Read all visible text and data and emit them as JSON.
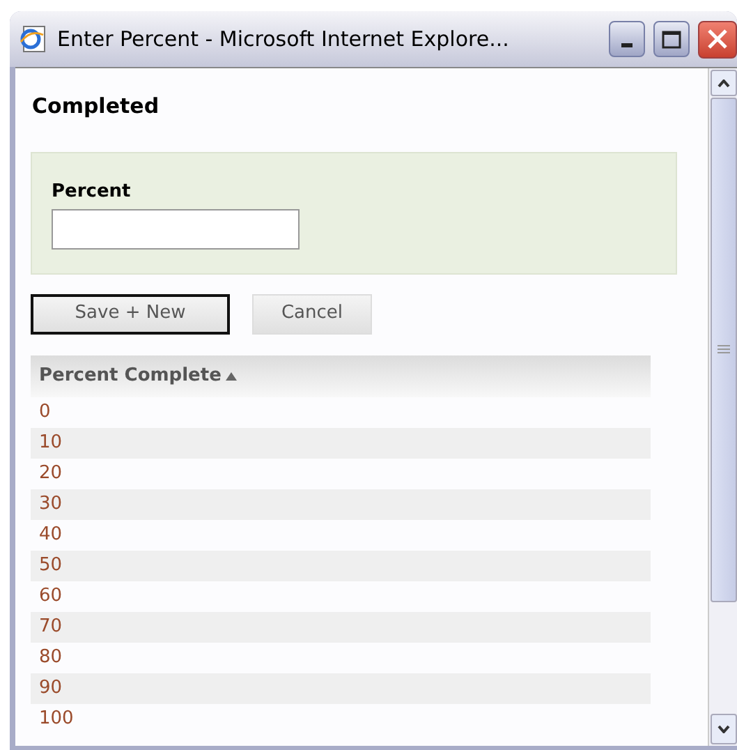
{
  "window": {
    "title": "Enter Percent - Microsoft Internet Explore..."
  },
  "heading": "Completed",
  "form": {
    "label": "Percent"
  },
  "buttons": [
    {
      "label": "Save + New",
      "focused": true
    },
    {
      "label": "Cancel",
      "focused": false
    }
  ],
  "table": {
    "column": "Percent Complete",
    "sorted_ascending": true,
    "rows": [
      "0",
      "10",
      "20",
      "30",
      "40",
      "50",
      "60",
      "70",
      "80",
      "90",
      "100"
    ]
  }
}
